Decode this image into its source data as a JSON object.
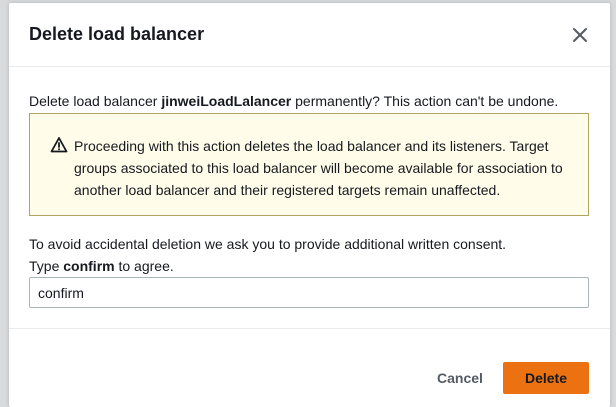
{
  "dialog": {
    "title": "Delete load balancer",
    "close_icon": "close-icon",
    "intro_prefix": "Delete load balancer ",
    "load_balancer_name": "jinweiLoadLalancer",
    "intro_suffix": " permanently? This action can't be undone.",
    "warning": {
      "icon": "warning-icon",
      "text": "Proceeding with this action deletes the load balancer and its listeners. Target groups associated to this load balancer will become available for association to another load balancer and their registered targets remain unaffected."
    },
    "consent": {
      "line1": "To avoid accidental deletion we ask you to provide additional written consent.",
      "line2_prefix": "Type ",
      "keyword": "confirm",
      "line2_suffix": " to agree."
    },
    "confirm_input": {
      "value": "confirm",
      "placeholder": ""
    },
    "buttons": {
      "cancel_label": "Cancel",
      "delete_label": "Delete"
    }
  },
  "colors": {
    "primary_button": "#ec7211",
    "warning_background": "#fffce9",
    "warning_border": "#b3a360",
    "warning_icon": "#8d6605"
  }
}
